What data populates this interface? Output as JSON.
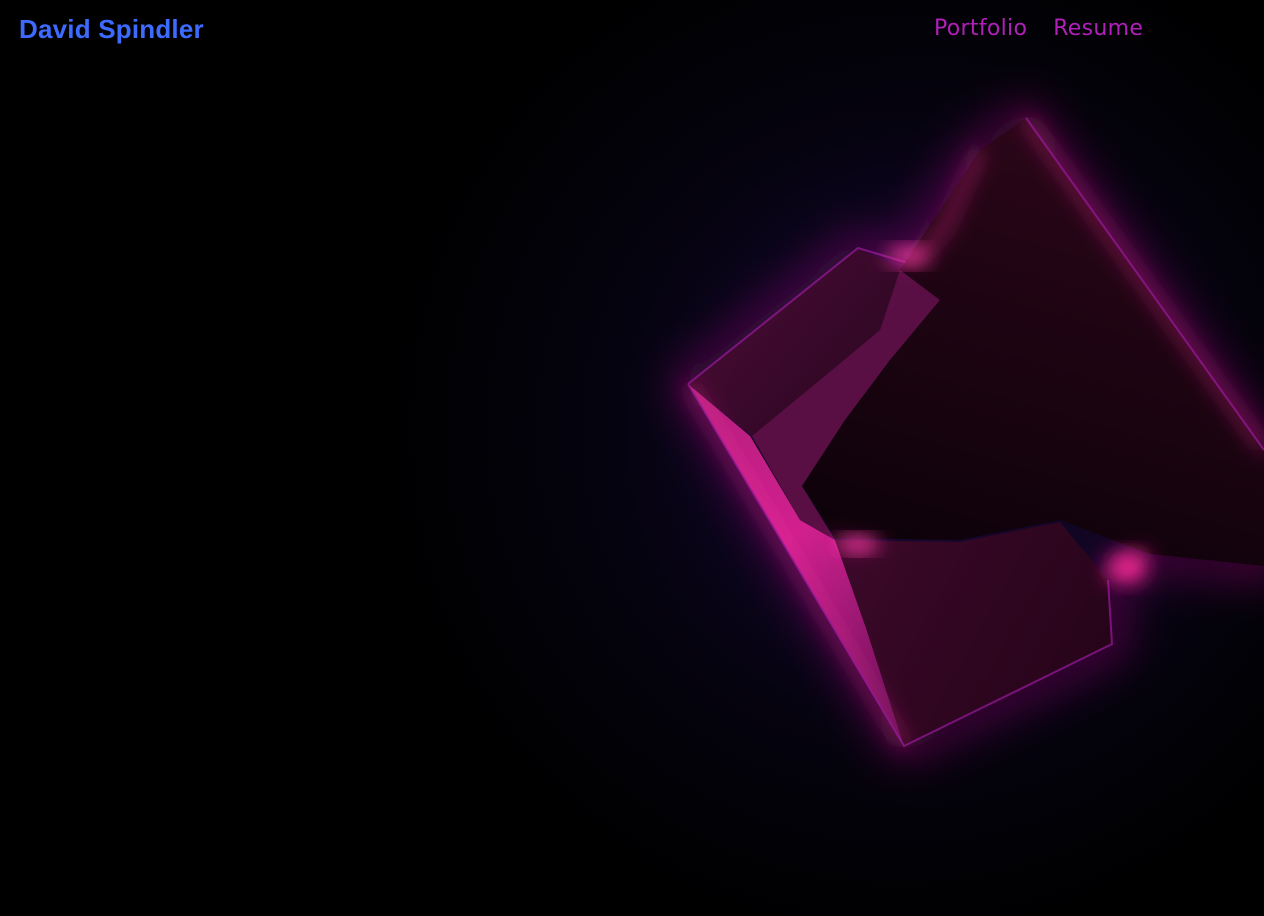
{
  "header": {
    "brand": "David Spindler",
    "nav": [
      {
        "label": "Portfolio"
      },
      {
        "label": "Resume"
      }
    ]
  },
  "colors": {
    "brand": "#3d6bff",
    "nav_link": "#b020b8",
    "background": "#000000",
    "glow": "#ff2aa0"
  }
}
